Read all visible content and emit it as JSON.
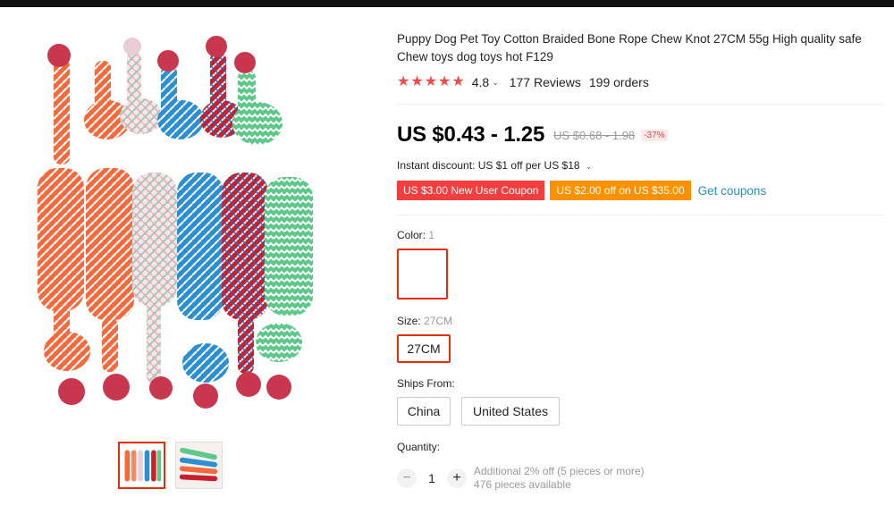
{
  "product": {
    "title": "Puppy Dog Pet Toy Cotton Braided Bone Rope Chew Knot 27CM 55g High quality safe Chew toys dog toys hot F129",
    "rating": "4.8",
    "reviews": "177 Reviews",
    "orders": "199 orders",
    "price": "US $0.43 - 1.25",
    "original_price": "US $0.68 - 1.98",
    "discount": "-37%",
    "instant_discount": "Instant discount: US $1 off per US $18",
    "coupons": [
      {
        "label": "US $3.00 New User Coupon",
        "color": "#f23e3e"
      },
      {
        "label": "US $2.00 off on US $35.00",
        "color": "#ff9000"
      }
    ],
    "get_coupons": "Get coupons"
  },
  "options": {
    "color_label": "Color:",
    "color_selected": "1",
    "size_label": "Size:",
    "size_selected": "27CM",
    "sizes": [
      "27CM"
    ],
    "ships_from_label": "Ships From:",
    "ships_from": [
      "China",
      "United States"
    ]
  },
  "quantity": {
    "label": "Quantity:",
    "value": "1",
    "note_line1": "Additional 2% off (5 pieces or more)",
    "note_line2": "476 pieces available"
  },
  "theme": {
    "accent": "#e62e04",
    "star": "#f44a4a",
    "link": "#2a8fbd"
  }
}
